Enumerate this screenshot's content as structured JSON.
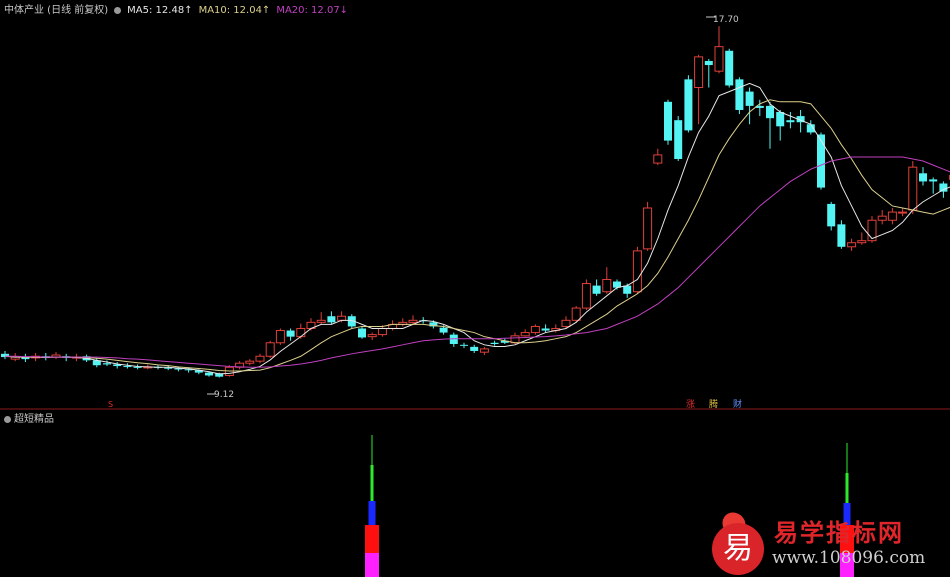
{
  "header": {
    "stock_label": "中体产业 (日线 前复权)",
    "ma5_label": "MA5: 12.48↑",
    "ma10_label": "MA10: 12.04↑",
    "ma20_label": "MA20: 12.07↓"
  },
  "sub_panel": {
    "indicator_name": "超短精品"
  },
  "annotations": {
    "high_price": "17.70",
    "low_price": "9.12",
    "marker_s": "S",
    "marker_zhang": "涨",
    "marker_teng": "腾",
    "marker_cai": "财"
  },
  "watermark": {
    "logo_char": "易",
    "title": "易学指标网",
    "url": "www.108096.com"
  },
  "colors": {
    "background": "#000000",
    "up_candle": "#e0403a",
    "down_candle": "#54f4f4",
    "ma5": "#e6e6e6",
    "ma10": "#dcd08c",
    "ma20": "#c040c0",
    "divider": "#8a1a1a",
    "bar_green": "#2ee82e",
    "bar_blue": "#1a2aff",
    "bar_red": "#ff1010",
    "bar_magenta": "#ff20ff"
  },
  "chart_data": {
    "type": "candlestick",
    "price_range": [
      8.5,
      18.0
    ],
    "candles": [
      [
        9.68,
        9.6,
        9.75,
        9.55
      ],
      [
        9.55,
        9.6,
        9.7,
        9.5
      ],
      [
        9.6,
        9.55,
        9.68,
        9.48
      ],
      [
        9.58,
        9.62,
        9.7,
        9.5
      ],
      [
        9.62,
        9.58,
        9.7,
        9.52
      ],
      [
        9.6,
        9.65,
        9.72,
        9.55
      ],
      [
        9.62,
        9.58,
        9.68,
        9.5
      ],
      [
        9.58,
        9.6,
        9.68,
        9.5
      ],
      [
        9.62,
        9.52,
        9.66,
        9.48
      ],
      [
        9.52,
        9.4,
        9.58,
        9.35
      ],
      [
        9.45,
        9.42,
        9.52,
        9.38
      ],
      [
        9.42,
        9.38,
        9.48,
        9.32
      ],
      [
        9.38,
        9.36,
        9.45,
        9.32
      ],
      [
        9.36,
        9.35,
        9.42,
        9.3
      ],
      [
        9.35,
        9.36,
        9.42,
        9.3
      ],
      [
        9.36,
        9.34,
        9.4,
        9.3
      ],
      [
        9.34,
        9.32,
        9.4,
        9.28
      ],
      [
        9.32,
        9.3,
        9.36,
        9.25
      ],
      [
        9.3,
        9.28,
        9.35,
        9.22
      ],
      [
        9.28,
        9.22,
        9.3,
        9.18
      ],
      [
        9.22,
        9.15,
        9.25,
        9.12
      ],
      [
        9.2,
        9.12,
        9.22,
        9.1
      ],
      [
        9.15,
        9.35,
        9.4,
        9.12
      ],
      [
        9.35,
        9.45,
        9.5,
        9.3
      ],
      [
        9.45,
        9.5,
        9.55,
        9.4
      ],
      [
        9.5,
        9.62,
        9.68,
        9.45
      ],
      [
        9.62,
        9.95,
        10.0,
        9.58
      ],
      [
        9.95,
        10.25,
        10.3,
        9.9
      ],
      [
        10.25,
        10.1,
        10.3,
        10.0
      ],
      [
        10.1,
        10.3,
        10.42,
        10.05
      ],
      [
        10.3,
        10.45,
        10.55,
        10.25
      ],
      [
        10.45,
        10.5,
        10.7,
        10.4
      ],
      [
        10.6,
        10.45,
        10.72,
        10.4
      ],
      [
        10.5,
        10.6,
        10.72,
        10.45
      ],
      [
        10.6,
        10.35,
        10.65,
        10.3
      ],
      [
        10.3,
        10.08,
        10.35,
        10.05
      ],
      [
        10.1,
        10.15,
        10.2,
        10.02
      ],
      [
        10.15,
        10.3,
        10.38,
        10.1
      ],
      [
        10.3,
        10.4,
        10.5,
        10.25
      ],
      [
        10.4,
        10.45,
        10.55,
        10.35
      ],
      [
        10.45,
        10.5,
        10.62,
        10.4
      ],
      [
        10.5,
        10.48,
        10.58,
        10.42
      ],
      [
        10.45,
        10.35,
        10.5,
        10.3
      ],
      [
        10.32,
        10.2,
        10.38,
        10.15
      ],
      [
        10.15,
        9.92,
        10.2,
        9.85
      ],
      [
        9.9,
        9.88,
        9.95,
        9.82
      ],
      [
        9.85,
        9.75,
        9.9,
        9.7
      ],
      [
        9.72,
        9.8,
        9.85,
        9.65
      ],
      [
        9.95,
        9.92,
        10.0,
        9.88
      ],
      [
        10.0,
        9.95,
        10.05,
        9.92
      ],
      [
        9.95,
        10.12,
        10.2,
        9.92
      ],
      [
        10.12,
        10.2,
        10.28,
        10.1
      ],
      [
        10.2,
        10.35,
        10.4,
        10.15
      ],
      [
        10.3,
        10.25,
        10.4,
        10.2
      ],
      [
        10.25,
        10.3,
        10.4,
        10.2
      ],
      [
        10.35,
        10.5,
        10.6,
        10.3
      ],
      [
        10.5,
        10.8,
        10.85,
        10.45
      ],
      [
        10.8,
        11.4,
        11.5,
        10.75
      ],
      [
        11.35,
        11.15,
        11.5,
        11.1
      ],
      [
        11.2,
        11.5,
        11.8,
        11.15
      ],
      [
        11.45,
        11.3,
        11.5,
        11.25
      ],
      [
        11.35,
        11.15,
        11.4,
        11.05
      ],
      [
        11.2,
        12.2,
        12.3,
        11.15
      ],
      [
        12.25,
        13.25,
        13.4,
        12.2
      ],
      [
        14.35,
        14.55,
        14.7,
        14.3
      ],
      [
        15.85,
        14.9,
        15.9,
        14.8
      ],
      [
        15.4,
        14.45,
        15.5,
        14.4
      ],
      [
        16.4,
        15.15,
        16.5,
        15.1
      ],
      [
        16.2,
        16.95,
        17.0,
        15.3
      ],
      [
        16.85,
        16.75,
        16.9,
        16.2
      ],
      [
        16.6,
        17.2,
        17.7,
        16.55
      ],
      [
        17.1,
        16.25,
        17.15,
        16.2
      ],
      [
        16.4,
        15.65,
        16.45,
        15.55
      ],
      [
        16.1,
        15.75,
        16.2,
        15.3
      ],
      [
        15.75,
        15.7,
        15.9,
        15.5
      ],
      [
        15.75,
        15.45,
        15.85,
        14.7
      ],
      [
        15.6,
        15.25,
        15.65,
        14.9
      ],
      [
        15.4,
        15.35,
        15.6,
        15.2
      ],
      [
        15.5,
        15.35,
        15.65,
        15.1
      ],
      [
        15.3,
        15.1,
        15.4,
        15.05
      ],
      [
        15.05,
        13.75,
        15.1,
        13.7
      ],
      [
        13.35,
        12.8,
        13.4,
        12.7
      ],
      [
        12.85,
        12.3,
        12.95,
        12.25
      ],
      [
        12.3,
        12.4,
        12.5,
        12.2
      ],
      [
        12.4,
        12.45,
        12.65,
        12.35
      ],
      [
        12.45,
        12.95,
        13.05,
        12.4
      ],
      [
        12.95,
        13.05,
        13.2,
        12.85
      ],
      [
        12.95,
        13.15,
        13.25,
        12.85
      ],
      [
        13.15,
        13.15,
        13.25,
        13.05
      ],
      [
        13.2,
        14.25,
        14.4,
        13.1
      ],
      [
        14.1,
        13.9,
        14.25,
        13.8
      ],
      [
        13.95,
        13.9,
        14.0,
        13.6
      ],
      [
        13.85,
        13.65,
        13.9,
        13.5
      ],
      [
        13.95,
        14.05,
        14.45,
        13.85
      ]
    ],
    "ma5": [
      9.62,
      9.6,
      9.6,
      9.6,
      9.59,
      9.6,
      9.6,
      9.59,
      9.57,
      9.52,
      9.48,
      9.43,
      9.4,
      9.37,
      9.36,
      9.35,
      9.35,
      9.33,
      9.31,
      9.28,
      9.24,
      9.19,
      9.2,
      9.24,
      9.3,
      9.37,
      9.53,
      9.74,
      9.92,
      10.1,
      10.3,
      10.4,
      10.4,
      10.5,
      10.5,
      10.4,
      10.3,
      10.3,
      10.3,
      10.3,
      10.4,
      10.5,
      10.47,
      10.4,
      10.3,
      10.2,
      10.0,
      9.9,
      9.86,
      9.86,
      9.9,
      10.0,
      10.1,
      10.2,
      10.25,
      10.3,
      10.45,
      10.7,
      10.9,
      11.1,
      11.3,
      11.35,
      11.5,
      11.9,
      12.5,
      13.2,
      13.8,
      14.5,
      15.1,
      15.5,
      16.0,
      16.1,
      16.2,
      16.3,
      16.2,
      15.8,
      15.6,
      15.5,
      15.4,
      15.3,
      14.9,
      14.5,
      13.8,
      13.3,
      12.8,
      12.5,
      12.6,
      12.7,
      12.9,
      13.2,
      13.4,
      13.55,
      13.7,
      13.8
    ],
    "ma10": [
      9.62,
      9.61,
      9.6,
      9.6,
      9.6,
      9.6,
      9.6,
      9.6,
      9.59,
      9.57,
      9.55,
      9.52,
      9.49,
      9.46,
      9.44,
      9.41,
      9.39,
      9.36,
      9.34,
      9.32,
      9.3,
      9.27,
      9.26,
      9.26,
      9.27,
      9.28,
      9.34,
      9.43,
      9.52,
      9.62,
      9.78,
      9.95,
      10.1,
      10.2,
      10.3,
      10.35,
      10.35,
      10.35,
      10.4,
      10.4,
      10.4,
      10.4,
      10.37,
      10.35,
      10.3,
      10.25,
      10.2,
      10.1,
      10.05,
      10.0,
      9.95,
      9.95,
      9.97,
      10.0,
      10.05,
      10.1,
      10.2,
      10.35,
      10.5,
      10.65,
      10.85,
      11.0,
      11.15,
      11.35,
      11.65,
      12.05,
      12.5,
      12.95,
      13.45,
      14.0,
      14.55,
      14.95,
      15.3,
      15.6,
      15.8,
      15.9,
      15.85,
      15.85,
      15.85,
      15.8,
      15.5,
      15.2,
      14.8,
      14.45,
      14.05,
      13.7,
      13.5,
      13.3,
      13.25,
      13.2,
      13.15,
      13.1,
      13.2,
      13.3
    ],
    "ma20": [
      9.62,
      9.62,
      9.61,
      9.61,
      9.6,
      9.6,
      9.6,
      9.6,
      9.6,
      9.6,
      9.59,
      9.58,
      9.56,
      9.55,
      9.53,
      9.51,
      9.49,
      9.47,
      9.45,
      9.43,
      9.41,
      9.39,
      9.37,
      9.36,
      9.35,
      9.35,
      9.36,
      9.38,
      9.4,
      9.43,
      9.47,
      9.52,
      9.58,
      9.63,
      9.68,
      9.72,
      9.76,
      9.8,
      9.85,
      9.9,
      9.95,
      10.0,
      10.02,
      10.04,
      10.05,
      10.05,
      10.05,
      10.05,
      10.05,
      10.06,
      10.07,
      10.08,
      10.09,
      10.1,
      10.12,
      10.14,
      10.17,
      10.2,
      10.25,
      10.3,
      10.4,
      10.5,
      10.6,
      10.75,
      10.9,
      11.1,
      11.3,
      11.55,
      11.8,
      12.05,
      12.3,
      12.55,
      12.8,
      13.05,
      13.3,
      13.5,
      13.7,
      13.9,
      14.05,
      14.2,
      14.3,
      14.4,
      14.45,
      14.5,
      14.5,
      14.5,
      14.5,
      14.5,
      14.5,
      14.45,
      14.4,
      14.3,
      14.2,
      14.1
    ],
    "signal_bars": [
      {
        "segments": [
          {
            "color": "green",
            "value": 0.9
          },
          {
            "color": "blue",
            "value": 0.6
          },
          {
            "color": "red",
            "value": 0.7
          },
          {
            "color": "magenta",
            "value": 0.6
          }
        ]
      },
      {
        "segments": [
          {
            "color": "green",
            "value": 0.75
          },
          {
            "color": "blue",
            "value": 0.55
          },
          {
            "color": "red",
            "value": 0.7
          },
          {
            "color": "magenta",
            "value": 0.6
          }
        ]
      }
    ]
  }
}
